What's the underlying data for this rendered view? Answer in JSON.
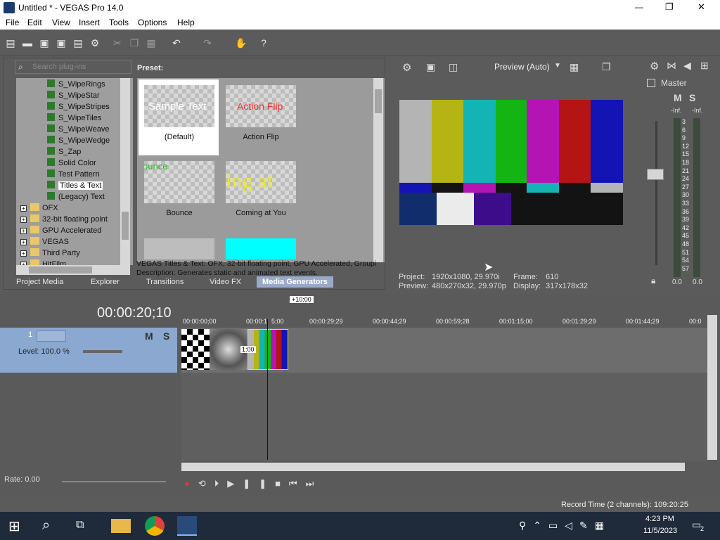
{
  "window": {
    "title": "Untitled * - VEGAS Pro 14.0",
    "minimize": "—",
    "maximize": "❐",
    "close": "✕"
  },
  "menu": [
    "File",
    "Edit",
    "View",
    "Insert",
    "Tools",
    "Options",
    "Help"
  ],
  "plugins": {
    "search_placeholder": "Search plug-ins",
    "tree": [
      {
        "label": "S_WipeRings",
        "kind": "plugin"
      },
      {
        "label": "S_WipeStar",
        "kind": "plugin"
      },
      {
        "label": "S_WipeStripes",
        "kind": "plugin"
      },
      {
        "label": "S_WipeTiles",
        "kind": "plugin"
      },
      {
        "label": "S_WipeWeave",
        "kind": "plugin"
      },
      {
        "label": "S_WipeWedge",
        "kind": "plugin"
      },
      {
        "label": "S_Zap",
        "kind": "plugin"
      },
      {
        "label": "Solid Color",
        "kind": "plugin"
      },
      {
        "label": "Test Pattern",
        "kind": "plugin"
      },
      {
        "label": "Titles & Text",
        "kind": "plugin",
        "selected": true
      },
      {
        "label": "(Legacy) Text",
        "kind": "plugin"
      },
      {
        "label": "OFX",
        "kind": "folder"
      },
      {
        "label": "32-bit floating point",
        "kind": "folder"
      },
      {
        "label": "GPU Accelerated",
        "kind": "folder"
      },
      {
        "label": "VEGAS",
        "kind": "folder"
      },
      {
        "label": "Third Party",
        "kind": "folder"
      },
      {
        "label": "HitFilm",
        "kind": "folder"
      }
    ],
    "preset_heading": "Preset:",
    "presets": [
      {
        "name": "(Default)",
        "thumb": "Sample Text"
      },
      {
        "name": "Action Flip",
        "thumb": "Action Flip"
      },
      {
        "name": "Bounce",
        "thumb": "ounce"
      },
      {
        "name": "Coming at You",
        "thumb": "ing at"
      }
    ],
    "info_line1": "VEGAS Titles & Text: OFX, 32-bit floating point, GPU Accelerated, Groupi",
    "info_line2": "Description: Generates static and animated text events."
  },
  "tabs": [
    "Project Media",
    "Explorer",
    "Transitions",
    "Video FX",
    "Media Generators"
  ],
  "active_tab": "Media Generators",
  "preview": {
    "mode": "Preview (Auto)",
    "project_label": "Project:",
    "project_value": "1920x1080, 29.970i",
    "preview_label": "Preview:",
    "preview_value": "480x270x32, 29.970p",
    "frame_label": "Frame:",
    "frame_value": "610",
    "display_label": "Display:",
    "display_value": "317x178x32"
  },
  "mixer": {
    "title": "Master",
    "m": "M",
    "s": "S",
    "left_peak": "-Inf.",
    "right_peak": "-Inf.",
    "scale": [
      "3",
      "6",
      "9",
      "12",
      "15",
      "18",
      "21",
      "24",
      "27",
      "30",
      "33",
      "36",
      "39",
      "42",
      "45",
      "48",
      "51",
      "54",
      "57"
    ],
    "left_val": "0.0",
    "right_val": "0.0"
  },
  "timeline": {
    "timecode": "00:00:20;10",
    "offset": "+10:00",
    "ruler": [
      "00:00:00;00",
      "00:00:1",
      "5;00",
      "00:00:29;29",
      "00:00:44;29",
      "00:00:59;28",
      "00:01:15;00",
      "00:01:29;29",
      "00:01:44;29",
      "00:0"
    ],
    "track_number": "1",
    "track_m": "M",
    "track_s": "S",
    "level": "Level: 100.0 %",
    "event_label": "1:00",
    "rate": "Rate: 0.00"
  },
  "status": {
    "record_time": "Record Time (2 channels): 109:20:25"
  },
  "taskbar": {
    "time": "4:23 PM",
    "date": "11/5/2023",
    "notif_count": "2"
  },
  "colors": {
    "accent": "#8aa8d0",
    "tab_active": "#9aa9c8"
  }
}
